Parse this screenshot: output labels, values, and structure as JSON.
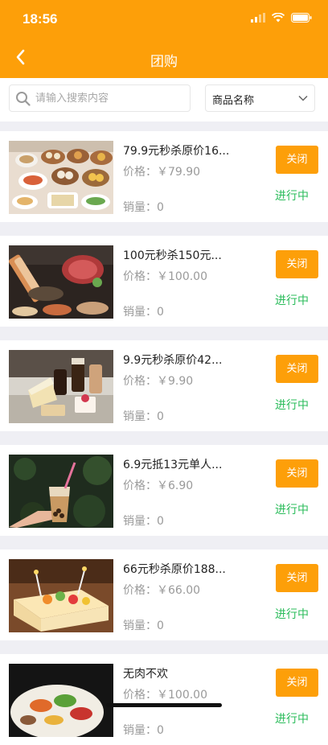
{
  "status_bar": {
    "time": "18:56"
  },
  "header": {
    "title": "团购"
  },
  "search": {
    "placeholder": "请输入搜索内容",
    "filter_selected": "商品名称"
  },
  "items": [
    {
      "name": "79.9元秒杀原价16...",
      "price": "价格：￥79.90",
      "sales": "销量：0",
      "action": "关闭",
      "status": "进行中"
    },
    {
      "name": "100元秒杀150元...",
      "price": "价格：￥100.00",
      "sales": "销量：0",
      "action": "关闭",
      "status": "进行中"
    },
    {
      "name": "9.9元秒杀原价42...",
      "price": "价格：￥9.90",
      "sales": "销量：0",
      "action": "关闭",
      "status": "进行中"
    },
    {
      "name": "6.9元抵13元单人...",
      "price": "价格：￥6.90",
      "sales": "销量：0",
      "action": "关闭",
      "status": "进行中"
    },
    {
      "name": "66元秒杀原价188...",
      "price": "价格：￥66.00",
      "sales": "销量：0",
      "action": "关闭",
      "status": "进行中"
    },
    {
      "name": "无肉不欢",
      "price": "价格：￥100.00",
      "sales": "销量：0",
      "action": "关闭",
      "status": "进行中"
    }
  ],
  "colors": {
    "accent": "#fd9f09",
    "status_active": "#2bbc5b"
  }
}
